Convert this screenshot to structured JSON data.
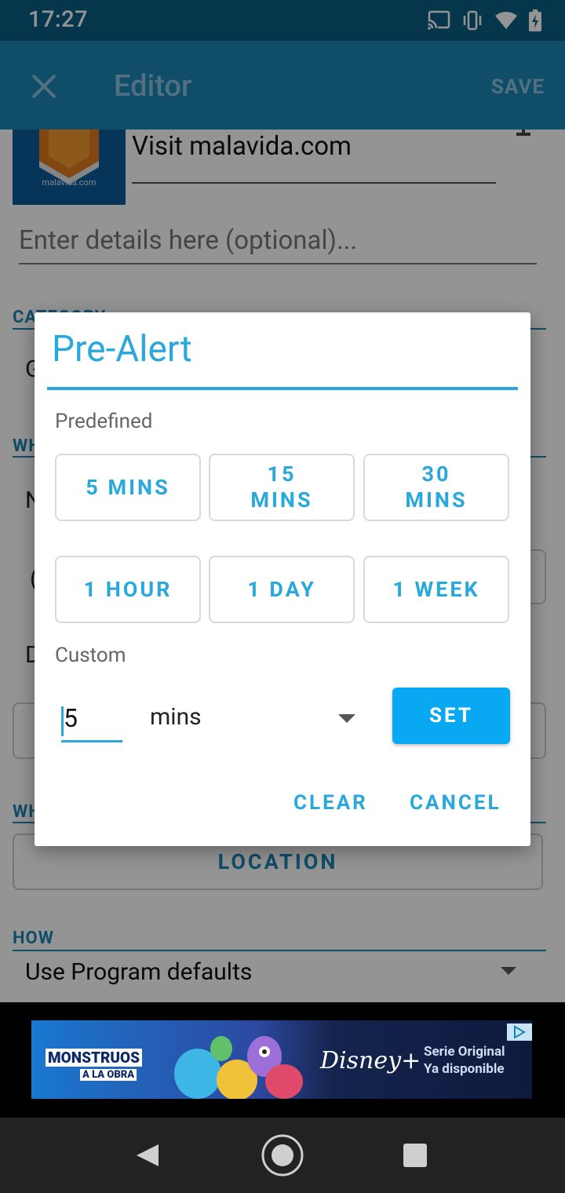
{
  "status_bar": {
    "time": "17:27"
  },
  "app_bar": {
    "title": "Editor",
    "save_label": "SAVE"
  },
  "editor": {
    "thumbnail_text": "malavida.com",
    "task_title": "Visit malavida.com",
    "details_placeholder": "Enter details here (optional)...",
    "sections": {
      "category": "CATEGORY",
      "when": "WHEN",
      "where": "WHERE",
      "how": "HOW"
    },
    "location_button": "LOCATION",
    "how_value": "Use Program defaults"
  },
  "dialog": {
    "title": "Pre-Alert",
    "predefined_label": "Predefined",
    "predefined_options": [
      "5 MINS",
      "15 MINS",
      "30 MINS",
      "1 HOUR",
      "1 DAY",
      "1 WEEK"
    ],
    "custom_label": "Custom",
    "custom_value": "5",
    "custom_unit": "mins",
    "set_label": "SET",
    "clear_label": "CLEAR",
    "cancel_label": "CANCEL"
  },
  "ad": {
    "brand_line1": "MONSTRUOS",
    "brand_line2": "A LA OBRA",
    "service": "Disney+",
    "tagline1": "Serie Original",
    "tagline2": "Ya disponible"
  },
  "colors": {
    "accent": "#29a8dc",
    "app_bar": "#1b86b6",
    "status_bar": "#0b5e83",
    "set_button": "#08a9f2"
  }
}
